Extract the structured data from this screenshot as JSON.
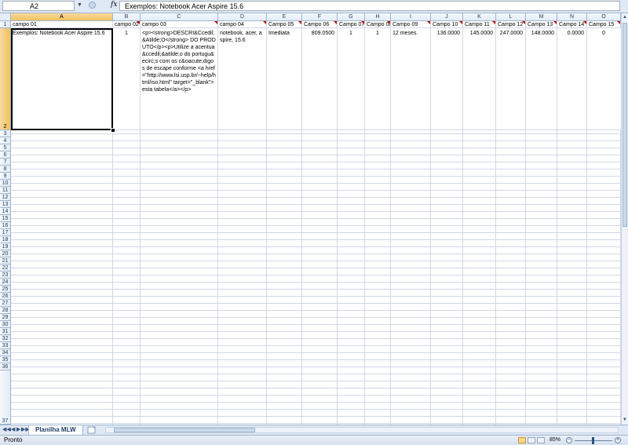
{
  "name_box": "A2",
  "fx_label": "fx",
  "formula": "Exemplos: Notebook Acer Aspire 15.6",
  "columns": [
    "A",
    "B",
    "C",
    "D",
    "E",
    "F",
    "G",
    "H",
    "I",
    "J",
    "K",
    "L",
    "M",
    "N",
    "O"
  ],
  "rows": [
    "1",
    "2",
    "3",
    "4",
    "5",
    "6",
    "7",
    "8",
    "9",
    "10",
    "11",
    "12",
    "13",
    "14",
    "15",
    "16",
    "17",
    "18",
    "19",
    "20",
    "21",
    "22",
    "23",
    "24",
    "25",
    "26",
    "27",
    "28",
    "29",
    "30",
    "31",
    "32",
    "33",
    "34",
    "35",
    "36",
    "37"
  ],
  "row1": [
    "campo 01",
    "campo 02",
    "campo 03",
    "campo 04",
    "Campo 05",
    "Campo 06",
    "Campo 07",
    "Campo 08",
    "Campo 09",
    "Campo 10",
    "Campo 11",
    "Campo 12",
    "Campo 13",
    "Campo 14",
    "Campo 15"
  ],
  "row2": {
    "a": "Exemplos: Notebook Acer Aspire 15.6",
    "b": "1",
    "c": "<p><strong>DESCRI&Ccedil;&Atilde;O</strong> DO PRODUTO</p><p>Utilize a acentua&ccedil;&atilde;o do portugu&ecirc;s com os c&oacute;digos de escape conforme <a href=\"http://www.lsi.usp.br/~help/html/iso.html\" target=\"_blank\">esta tabela</a></p>",
    "d": "notebook, acer, aspire, 15.6",
    "e": "Imediata",
    "f": "809.0500",
    "g": "1",
    "h": "1",
    "i": "12 meses.",
    "j": "136.0000",
    "k": "145.0000",
    "l": "247.0000",
    "m": "148.0000",
    "n": "0.0000",
    "o": "0"
  },
  "sheet_tab": "Planilha MLW",
  "status": "Pronto",
  "zoom": "85%",
  "zoom_minus": "−",
  "zoom_plus": "+",
  "nav": {
    "first": "◀◀",
    "prev": "◀",
    "next": "▶",
    "last": "▶▶"
  },
  "scroll": {
    "up": "▲",
    "down": "▼",
    "dropdown": "▼"
  }
}
